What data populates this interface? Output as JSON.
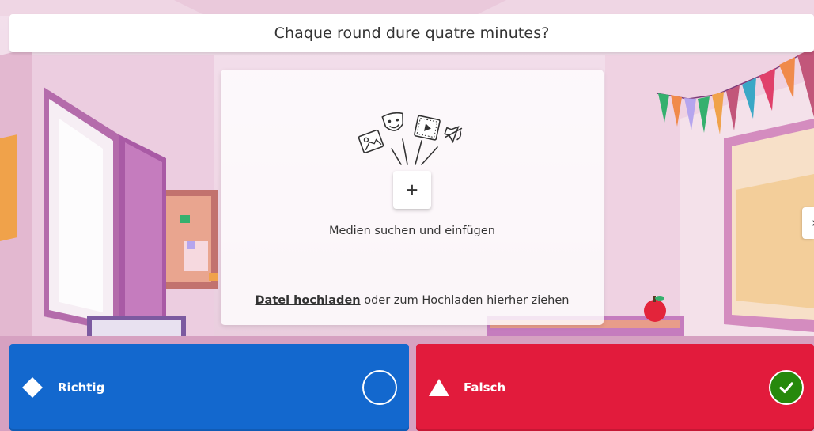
{
  "question": {
    "text": "Chaque round dure quatre minutes?"
  },
  "media_panel": {
    "hint": "Medien suchen und einfügen",
    "upload_link": "Datei hochladen",
    "upload_suffix": " oder zum Hochladen hierher ziehen",
    "add_icon": "plus-icon",
    "illustration_icons": [
      "image-icon",
      "theater-mask-icon",
      "video-icon",
      "sound-icon"
    ]
  },
  "answers": [
    {
      "label": "Richtig",
      "shape": "diamond",
      "color": "#1368ce",
      "selected": false
    },
    {
      "label": "Falsch",
      "shape": "triangle",
      "color": "#e21b3c",
      "selected": true
    }
  ],
  "side_arrow": {
    "icon": "chevron-right-icon",
    "glyph": "›"
  },
  "colors": {
    "correct_check": "#26890c",
    "true_answer": "#1368ce",
    "false_answer": "#e21b3c"
  }
}
